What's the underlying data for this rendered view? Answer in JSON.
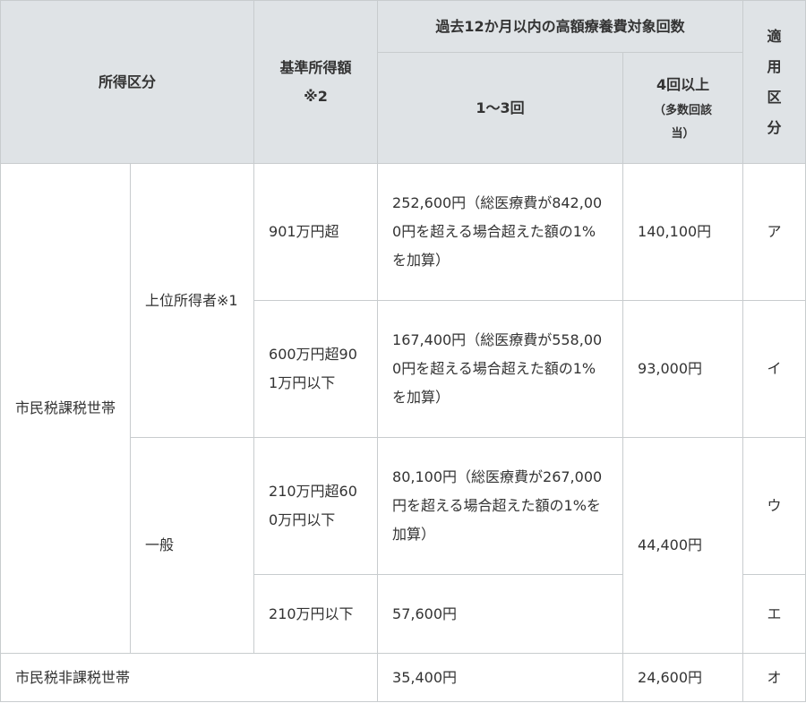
{
  "headers": {
    "income_category": "所得区分",
    "base_income_line1": "基準所得額",
    "base_income_line2": "※2",
    "times_group": "過去12か月以内の高額療養費対象回数",
    "times_1_3": "1～3回",
    "times_4plus_line1": "4回以上",
    "times_4plus_line2": "（多数回該",
    "times_4plus_line3": "当）",
    "category_vertical": [
      "適",
      "用",
      "区",
      "分"
    ]
  },
  "rows": {
    "taxed_household": "市民税課税世帯",
    "upper_income": "上位所得者※1",
    "general": "一般",
    "nontaxed_household": "市民税非課税世帯"
  },
  "cells": [
    {
      "base_income": "901万円超",
      "amount": "252,600円",
      "note": "（総医療費が842,000円を超える場合超えた額の1%を加算）",
      "multi": "140,100円",
      "category": "ア"
    },
    {
      "base_income": "600万円超901万円以下",
      "amount": "167,400円",
      "note": "（総医療費が558,000円を超える場合超えた額の1%を加算）",
      "multi": "93,000円",
      "category": "イ"
    },
    {
      "base_income": "210万円超600万円以下",
      "amount": "80,100円",
      "note": "（総医療費が267,000円を超える場合超えた額の1%を加算）",
      "multi": "44,400円",
      "category": "ウ"
    },
    {
      "base_income": "210万円以下",
      "amount": "57,600円",
      "note": "",
      "multi": "",
      "category": "エ"
    }
  ],
  "nontaxed": {
    "amount": "35,400円",
    "multi": "24,600円",
    "category": "オ"
  }
}
